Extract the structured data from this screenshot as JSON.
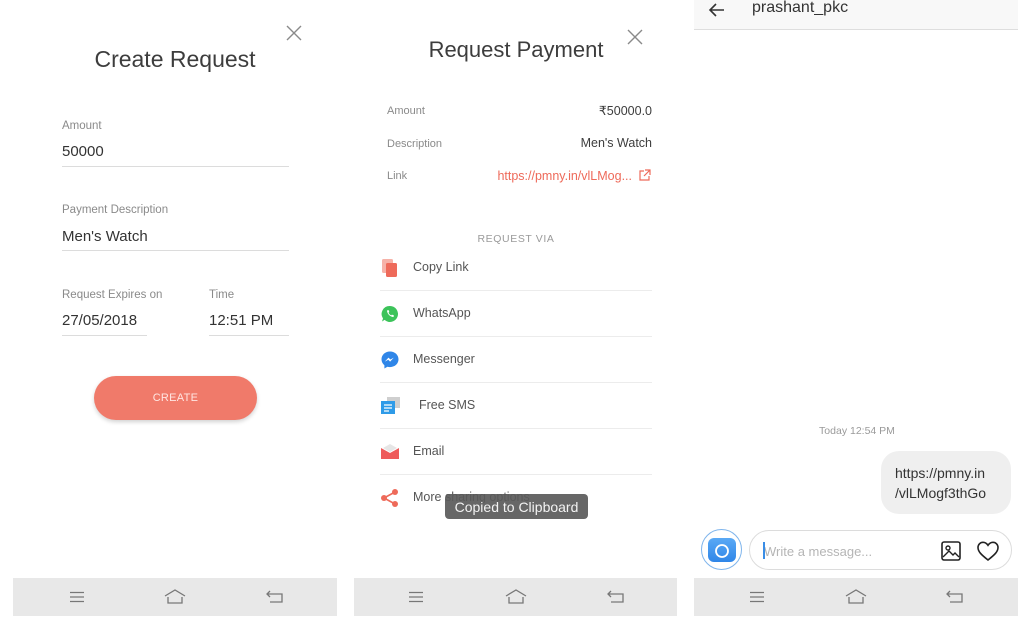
{
  "create_request": {
    "title": "Create Request",
    "close_icon": "close-icon",
    "amount_label": "Amount",
    "amount_value": "50000",
    "description_label": "Payment Description",
    "description_value": "Men's Watch",
    "expires_label": "Request Expires on",
    "expires_value": "27/05/2018",
    "time_label": "Time",
    "time_value": "12:51 PM",
    "create_button": "CREATE"
  },
  "request_payment": {
    "title": "Request Payment",
    "close_icon": "close-icon",
    "amount_label": "Amount",
    "amount_value": "₹50000.0",
    "description_label": "Description",
    "description_value": "Men's Watch",
    "link_label": "Link",
    "link_value": "https://pmny.in/vlLMog...",
    "request_via_label": "REQUEST VIA",
    "share_options": [
      {
        "label": "Copy Link",
        "icon": "copy-icon"
      },
      {
        "label": "WhatsApp",
        "icon": "whatsapp-icon"
      },
      {
        "label": "Messenger",
        "icon": "messenger-icon"
      },
      {
        "label": "Free SMS",
        "icon": "sms-icon"
      },
      {
        "label": "Email",
        "icon": "email-icon"
      },
      {
        "label": "More sharing options",
        "icon": "share-icon"
      }
    ],
    "toast": "Copied to Clipboard"
  },
  "chat": {
    "contact_name": "prashant_pkc",
    "timestamp": "Today 12:54 PM",
    "message_line1": "https://pmny.in",
    "message_line2": "/vlLMogf3thGo",
    "input_placeholder": "Write a message..."
  },
  "navbar": {
    "icons": [
      "menu-icon",
      "home-icon",
      "back-icon"
    ]
  },
  "colors": {
    "accent": "#f07a6a",
    "link": "#ee6a5a",
    "navbar_bg": "#e8e8e8",
    "messenger_blue": "#2f86e8",
    "whatsapp_green": "#3cc35a"
  }
}
